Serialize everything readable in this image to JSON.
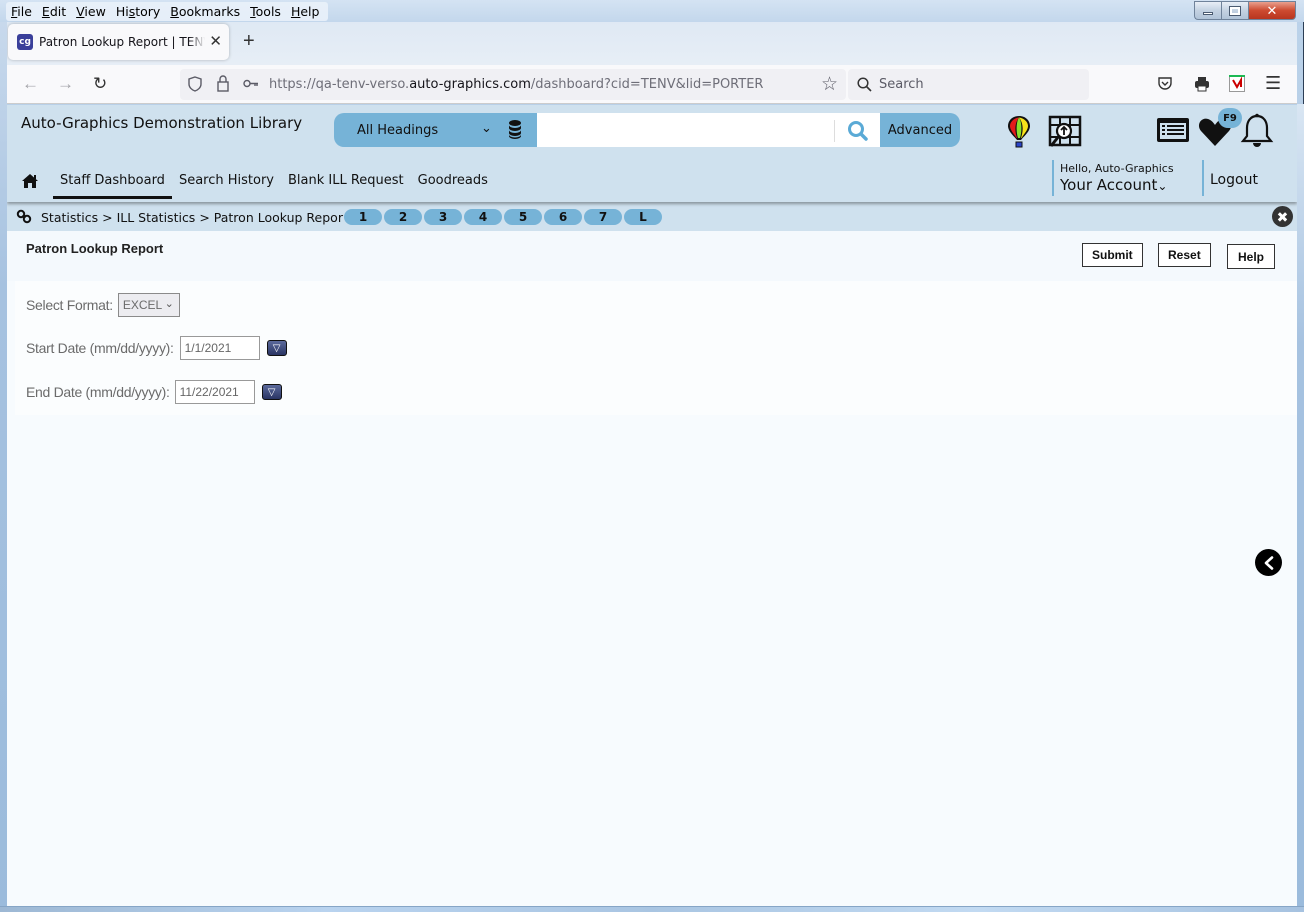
{
  "browser": {
    "menu": [
      {
        "label": "File",
        "accesskey_index": 0
      },
      {
        "label": "Edit",
        "accesskey_index": 0
      },
      {
        "label": "View",
        "accesskey_index": 0
      },
      {
        "label": "History",
        "accesskey_index": 2
      },
      {
        "label": "Bookmarks",
        "accesskey_index": 0
      },
      {
        "label": "Tools",
        "accesskey_index": 0
      },
      {
        "label": "Help",
        "accesskey_index": 0
      }
    ],
    "window_controls": {
      "minimize": "—",
      "maximize": "▢",
      "close": "✕"
    },
    "tab": {
      "favicon": "cg",
      "title": "Patron Lookup Report | TENV | p",
      "close": "✕"
    },
    "new_tab": "+",
    "nav": {
      "back": "←",
      "forward": "→",
      "reload": "↻"
    },
    "url": {
      "prefix": "https://qa-tenv-verso.",
      "host": "auto-graphics.com",
      "path": "/dashboard?cid=TENV&lid=PORTER"
    },
    "search_placeholder": "Search"
  },
  "app": {
    "library_name": "Auto-Graphics Demonstration Library",
    "search": {
      "heading_selected": "All Headings",
      "query": "",
      "advanced_label": "Advanced"
    },
    "badge_f9": "F9",
    "nav": [
      {
        "label": "Staff Dashboard",
        "active": true
      },
      {
        "label": "Search History",
        "active": false
      },
      {
        "label": "Blank ILL Request",
        "active": false
      },
      {
        "label": "Goodreads",
        "active": false
      }
    ],
    "account": {
      "greeting": "Hello, Auto-Graphics",
      "label": "Your Account",
      "chevron": "⌄"
    },
    "logout_label": "Logout",
    "breadcrumb": {
      "items": [
        "Statistics",
        "ILL Statistics",
        "Patron Lookup Report"
      ],
      "separator": ">",
      "text": "Statistics > ILL Statistics > Patron Lookup Report"
    },
    "quick_pills": [
      "1",
      "2",
      "3",
      "4",
      "5",
      "6",
      "7",
      "L"
    ],
    "colors": {
      "accent": "#76b3d7",
      "header_bg": "#cfe1ee"
    }
  },
  "report": {
    "title": "Patron Lookup Report",
    "buttons": {
      "submit": "Submit",
      "reset": "Reset",
      "help": "Help"
    },
    "format_label": "Select Format:",
    "format_value": "EXCEL",
    "start_label": "Start Date (mm/dd/yyyy):",
    "start_value": "1/1/2021",
    "end_label": "End Date (mm/dd/yyyy):",
    "end_value": "11/22/2021"
  }
}
